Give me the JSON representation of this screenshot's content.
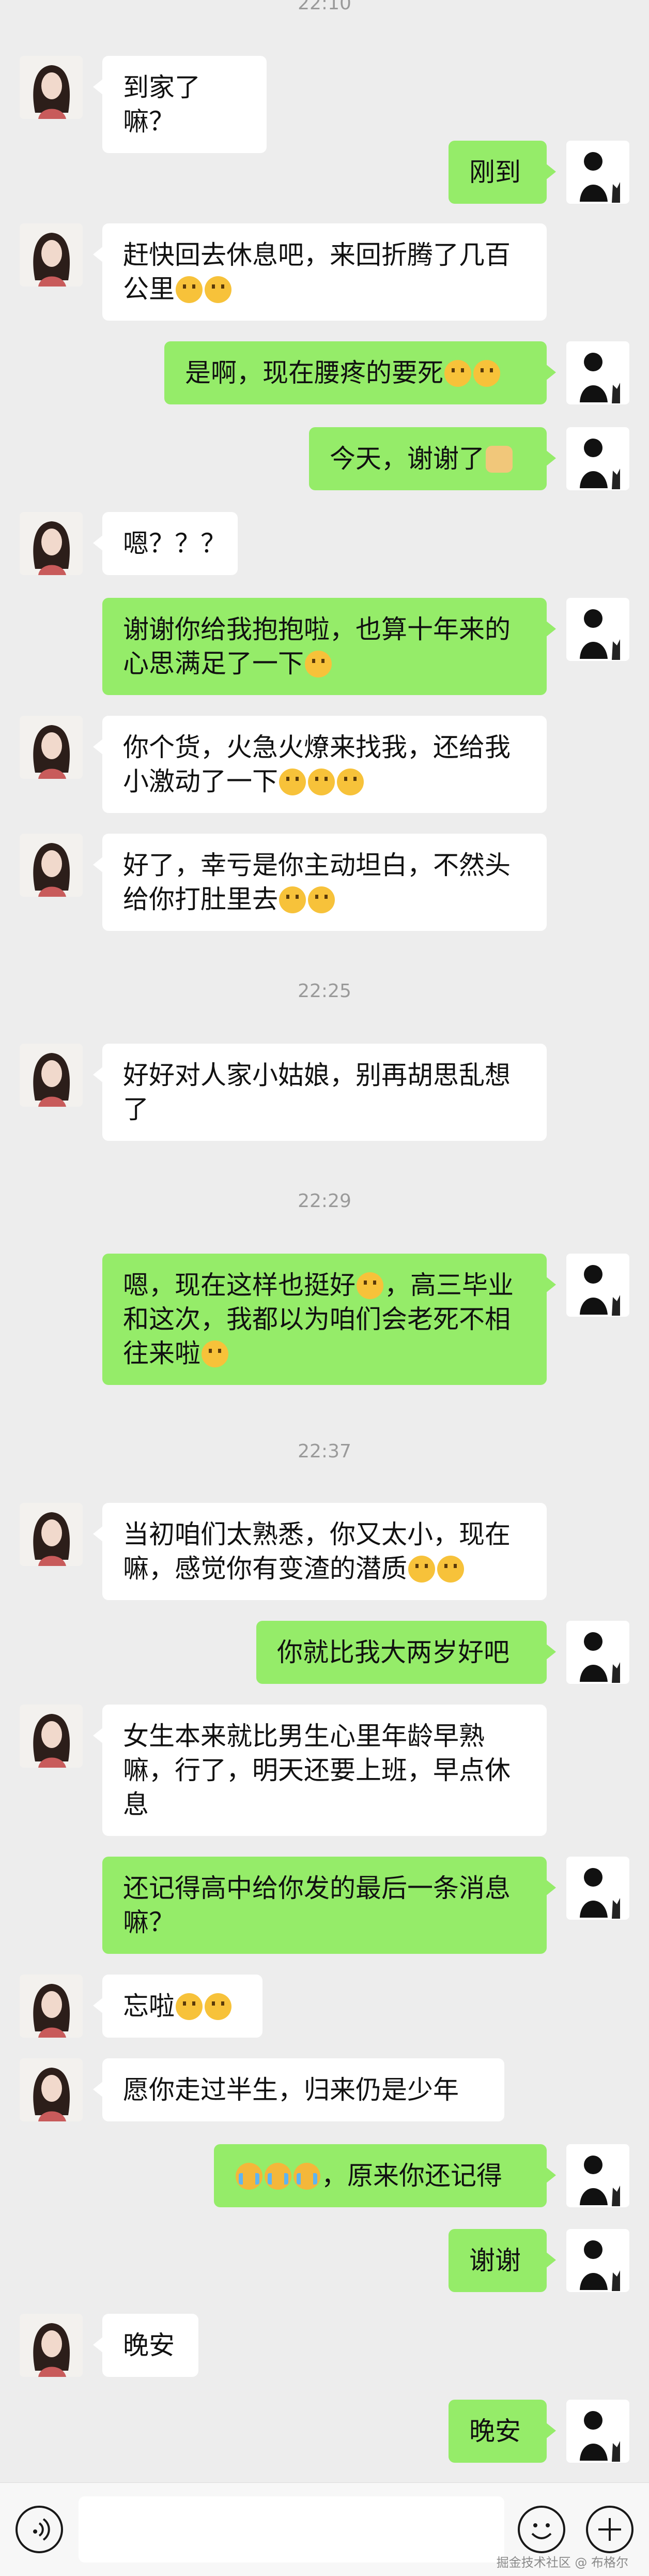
{
  "timestamps": [
    "22:10",
    "22:25",
    "22:29",
    "22:37"
  ],
  "messages": [
    {
      "side": "left",
      "text": "到家了嘛？"
    },
    {
      "side": "right",
      "text": "刚到"
    },
    {
      "side": "left",
      "text": "赶快回去休息吧，来回折腾了几百公里",
      "emoji": [
        "laugh-cry",
        "laugh-cry"
      ]
    },
    {
      "side": "right",
      "text": "是啊，现在腰疼的要死",
      "emoji": [
        "sweat",
        "sweat"
      ]
    },
    {
      "side": "right",
      "text": "今天，谢谢了",
      "emoji": [
        "doge"
      ]
    },
    {
      "side": "left",
      "text": "嗯？？？"
    },
    {
      "side": "right",
      "text": "谢谢你给我抱抱啦，也算十年来的心思满足了一下",
      "emoji": [
        "smile"
      ]
    },
    {
      "side": "left",
      "text": "你个货，火急火燎来找我，还给我小激动了一下",
      "emoji": [
        "rofl",
        "rofl",
        "rofl"
      ]
    },
    {
      "side": "left",
      "text": "好了，幸亏是你主动坦白，不然头给你打肚里去",
      "emoji": [
        "facepalm",
        "facepalm"
      ]
    },
    {
      "side": "left",
      "text": "好好对人家小姑娘，别再胡思乱想了"
    },
    {
      "side": "right",
      "text": "嗯，现在这样也挺好",
      "emoji_mid": [
        "smile"
      ],
      "text2": "，高三毕业和这次，我都以为咱们会老死不相往来啦",
      "emoji": [
        "sweat"
      ]
    },
    {
      "side": "left",
      "text": "当初咱们太熟悉，你又太小，现在嘛，感觉你有变渣的潜质",
      "emoji": [
        "flushed",
        "flushed"
      ]
    },
    {
      "side": "right",
      "text": "你就比我大两岁好吧"
    },
    {
      "side": "left",
      "text": "女生本来就比男生心里年龄早熟嘛，行了，明天还要上班，早点休息"
    },
    {
      "side": "right",
      "text": "还记得高中给你发的最后一条消息嘛？"
    },
    {
      "side": "left",
      "text": "忘啦",
      "emoji": [
        "grin",
        "grin"
      ]
    },
    {
      "side": "left",
      "text": "愿你走过半生，归来仍是少年"
    },
    {
      "side": "right",
      "text_pre_emoji": [
        "cry",
        "cry",
        "cry"
      ],
      "text": "，原来你还记得"
    },
    {
      "side": "right",
      "text": "谢谢"
    },
    {
      "side": "left",
      "text": "晚安"
    },
    {
      "side": "right",
      "text": "晚安"
    }
  ],
  "toolbar": {
    "voice_icon": "voice-icon",
    "emoji_icon": "emoji-icon",
    "plus_icon": "plus-icon",
    "watermark": "掘金技术社区 @ 布格尔"
  },
  "colors": {
    "background": "#ededed",
    "bubble_self": "#95ec69",
    "bubble_other": "#ffffff",
    "timestamp": "#9a9a9a"
  }
}
